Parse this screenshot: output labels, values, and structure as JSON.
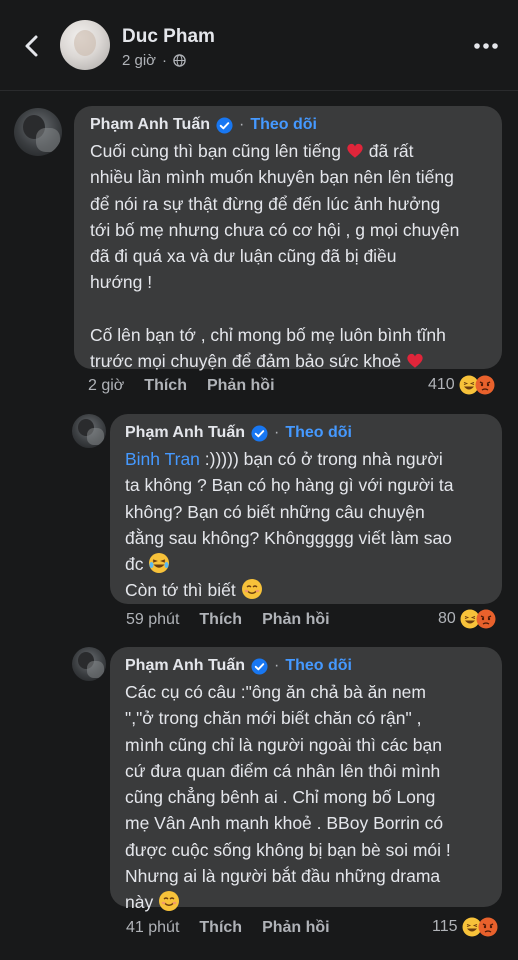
{
  "header": {
    "name": "Duc Pham",
    "time": "2 giờ"
  },
  "comments": [
    {
      "author": "Phạm Anh Tuấn",
      "follow": "Theo dõi",
      "lines": [
        "Cuối cùng thì bạn cũng lên tiếng",
        "nhiều lần mình muốn khuyên bạn nên lên tiếng",
        "để nói ra sự thật đừng để đến lúc ảnh hưởng",
        "tới bố mẹ nhưng chưa có cơ hội , g mọi chuyện",
        "đã đi quá xa và dư luận cũng đã bị điều",
        "hướng !",
        "Cố lên bạn tớ , chỉ mong bố mẹ luôn bình tĩnh",
        "trước mọi chuyện để đảm bảo sức khoẻ"
      ],
      "line1_tail": "đã rất",
      "time": "2 giờ",
      "like": "Thích",
      "reply": "Phản hồi",
      "reactions": "410"
    },
    {
      "author": "Phạm Anh Tuấn",
      "follow": "Theo dõi",
      "mention": "Binh Tran",
      "lines": [
        " :))))) bạn có ở trong nhà người",
        "ta không ? Bạn có họ hàng gì với người ta",
        "không? Bạn có biết những câu chuyện",
        "đằng sau không? Khônggggg viết làm sao",
        "đc",
        "Còn tớ thì biết"
      ],
      "time": "59 phút",
      "like": "Thích",
      "reply": "Phản hồi",
      "reactions": "80"
    },
    {
      "author": "Phạm Anh Tuấn",
      "follow": "Theo dõi",
      "lines": [
        "Các cụ có câu :\"ông ăn chả bà ăn nem",
        "\",\"ở trong chăn mới biết chăn có rận\" ,",
        "mình cũng chỉ là người ngoài thì các bạn",
        "cứ đưa quan điểm cá nhân lên thôi mình",
        "cũng chẳng bênh ai . Chỉ mong bố Long",
        "mẹ Vân Anh mạnh khoẻ . BBoy Borrin có",
        "được cuộc sống không bị bạn bè soi mói !",
        "Nhưng ai là người bắt đầu những drama",
        "này"
      ],
      "time": "41 phút",
      "like": "Thích",
      "reply": "Phản hồi",
      "reactions": "115"
    }
  ],
  "icons": {
    "back": "back-arrow-icon",
    "more": "more-options-icon",
    "verified": "verified-badge-icon",
    "globe": "globe-icon"
  },
  "colors": {
    "background": "#18191a",
    "bubble": "#3a3b3c",
    "link": "#4599ff",
    "verified": "#1877f2",
    "heart": "#e0253a"
  }
}
